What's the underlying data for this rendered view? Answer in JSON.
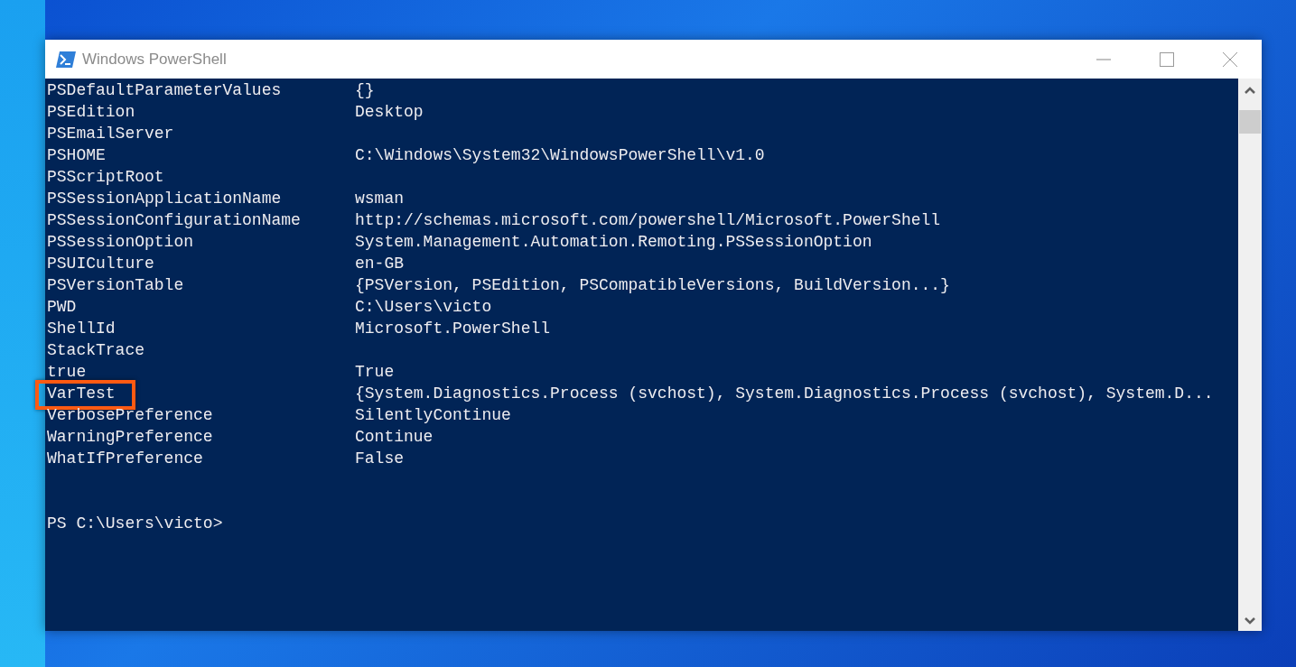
{
  "window": {
    "title": "Windows PowerShell"
  },
  "rows": [
    {
      "name": "PSDefaultParameterValues",
      "value": "{}",
      "highlighted": false
    },
    {
      "name": "PSEdition",
      "value": "Desktop",
      "highlighted": false
    },
    {
      "name": "PSEmailServer",
      "highlighted": false
    },
    {
      "name": "PSHOME",
      "value": "C:\\Windows\\System32\\WindowsPowerShell\\v1.0",
      "highlighted": false
    },
    {
      "name": "PSScriptRoot",
      "highlighted": false
    },
    {
      "name": "PSSessionApplicationName",
      "value": "wsman",
      "highlighted": false
    },
    {
      "name": "PSSessionConfigurationName",
      "value": "http://schemas.microsoft.com/powershell/Microsoft.PowerShell",
      "highlighted": false
    },
    {
      "name": "PSSessionOption",
      "value": "System.Management.Automation.Remoting.PSSessionOption",
      "highlighted": false
    },
    {
      "name": "PSUICulture",
      "value": "en-GB",
      "highlighted": false
    },
    {
      "name": "PSVersionTable",
      "value": "{PSVersion, PSEdition, PSCompatibleVersions, BuildVersion...}",
      "highlighted": false
    },
    {
      "name": "PWD",
      "value": "C:\\Users\\victo",
      "highlighted": false
    },
    {
      "name": "ShellId",
      "value": "Microsoft.PowerShell",
      "highlighted": false
    },
    {
      "name": "StackTrace",
      "highlighted": false
    },
    {
      "name": "true",
      "value": "True",
      "highlighted": false
    },
    {
      "name": "VarTest",
      "value": "{System.Diagnostics.Process (svchost), System.Diagnostics.Process (svchost), System.D...",
      "highlighted": true
    },
    {
      "name": "VerbosePreference",
      "value": "SilentlyContinue",
      "highlighted": false
    },
    {
      "name": "WarningPreference",
      "value": "Continue",
      "highlighted": false
    },
    {
      "name": "WhatIfPreference",
      "value": "False",
      "highlighted": false
    }
  ],
  "prompt": "PS C:\\Users\\victo>"
}
